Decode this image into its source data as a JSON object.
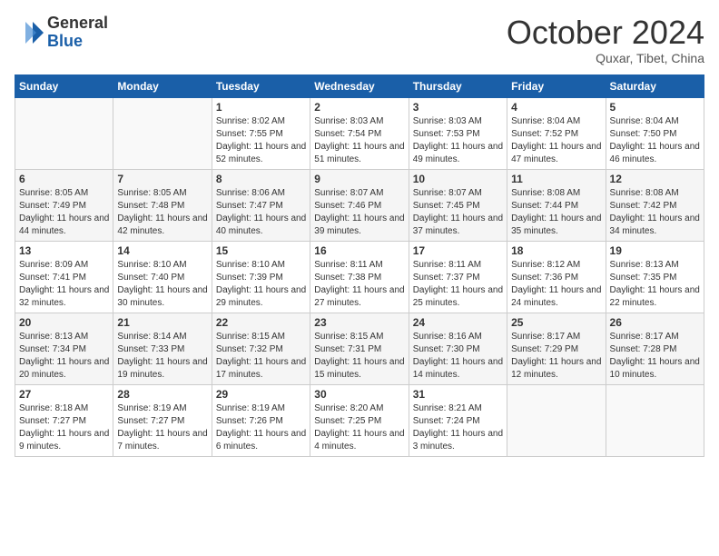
{
  "logo": {
    "general": "General",
    "blue": "Blue"
  },
  "title": "October 2024",
  "subtitle": "Quxar, Tibet, China",
  "days_header": [
    "Sunday",
    "Monday",
    "Tuesday",
    "Wednesday",
    "Thursday",
    "Friday",
    "Saturday"
  ],
  "weeks": [
    [
      {
        "num": "",
        "info": ""
      },
      {
        "num": "",
        "info": ""
      },
      {
        "num": "1",
        "info": "Sunrise: 8:02 AM\nSunset: 7:55 PM\nDaylight: 11 hours and 52 minutes."
      },
      {
        "num": "2",
        "info": "Sunrise: 8:03 AM\nSunset: 7:54 PM\nDaylight: 11 hours and 51 minutes."
      },
      {
        "num": "3",
        "info": "Sunrise: 8:03 AM\nSunset: 7:53 PM\nDaylight: 11 hours and 49 minutes."
      },
      {
        "num": "4",
        "info": "Sunrise: 8:04 AM\nSunset: 7:52 PM\nDaylight: 11 hours and 47 minutes."
      },
      {
        "num": "5",
        "info": "Sunrise: 8:04 AM\nSunset: 7:50 PM\nDaylight: 11 hours and 46 minutes."
      }
    ],
    [
      {
        "num": "6",
        "info": "Sunrise: 8:05 AM\nSunset: 7:49 PM\nDaylight: 11 hours and 44 minutes."
      },
      {
        "num": "7",
        "info": "Sunrise: 8:05 AM\nSunset: 7:48 PM\nDaylight: 11 hours and 42 minutes."
      },
      {
        "num": "8",
        "info": "Sunrise: 8:06 AM\nSunset: 7:47 PM\nDaylight: 11 hours and 40 minutes."
      },
      {
        "num": "9",
        "info": "Sunrise: 8:07 AM\nSunset: 7:46 PM\nDaylight: 11 hours and 39 minutes."
      },
      {
        "num": "10",
        "info": "Sunrise: 8:07 AM\nSunset: 7:45 PM\nDaylight: 11 hours and 37 minutes."
      },
      {
        "num": "11",
        "info": "Sunrise: 8:08 AM\nSunset: 7:44 PM\nDaylight: 11 hours and 35 minutes."
      },
      {
        "num": "12",
        "info": "Sunrise: 8:08 AM\nSunset: 7:42 PM\nDaylight: 11 hours and 34 minutes."
      }
    ],
    [
      {
        "num": "13",
        "info": "Sunrise: 8:09 AM\nSunset: 7:41 PM\nDaylight: 11 hours and 32 minutes."
      },
      {
        "num": "14",
        "info": "Sunrise: 8:10 AM\nSunset: 7:40 PM\nDaylight: 11 hours and 30 minutes."
      },
      {
        "num": "15",
        "info": "Sunrise: 8:10 AM\nSunset: 7:39 PM\nDaylight: 11 hours and 29 minutes."
      },
      {
        "num": "16",
        "info": "Sunrise: 8:11 AM\nSunset: 7:38 PM\nDaylight: 11 hours and 27 minutes."
      },
      {
        "num": "17",
        "info": "Sunrise: 8:11 AM\nSunset: 7:37 PM\nDaylight: 11 hours and 25 minutes."
      },
      {
        "num": "18",
        "info": "Sunrise: 8:12 AM\nSunset: 7:36 PM\nDaylight: 11 hours and 24 minutes."
      },
      {
        "num": "19",
        "info": "Sunrise: 8:13 AM\nSunset: 7:35 PM\nDaylight: 11 hours and 22 minutes."
      }
    ],
    [
      {
        "num": "20",
        "info": "Sunrise: 8:13 AM\nSunset: 7:34 PM\nDaylight: 11 hours and 20 minutes."
      },
      {
        "num": "21",
        "info": "Sunrise: 8:14 AM\nSunset: 7:33 PM\nDaylight: 11 hours and 19 minutes."
      },
      {
        "num": "22",
        "info": "Sunrise: 8:15 AM\nSunset: 7:32 PM\nDaylight: 11 hours and 17 minutes."
      },
      {
        "num": "23",
        "info": "Sunrise: 8:15 AM\nSunset: 7:31 PM\nDaylight: 11 hours and 15 minutes."
      },
      {
        "num": "24",
        "info": "Sunrise: 8:16 AM\nSunset: 7:30 PM\nDaylight: 11 hours and 14 minutes."
      },
      {
        "num": "25",
        "info": "Sunrise: 8:17 AM\nSunset: 7:29 PM\nDaylight: 11 hours and 12 minutes."
      },
      {
        "num": "26",
        "info": "Sunrise: 8:17 AM\nSunset: 7:28 PM\nDaylight: 11 hours and 10 minutes."
      }
    ],
    [
      {
        "num": "27",
        "info": "Sunrise: 8:18 AM\nSunset: 7:27 PM\nDaylight: 11 hours and 9 minutes."
      },
      {
        "num": "28",
        "info": "Sunrise: 8:19 AM\nSunset: 7:27 PM\nDaylight: 11 hours and 7 minutes."
      },
      {
        "num": "29",
        "info": "Sunrise: 8:19 AM\nSunset: 7:26 PM\nDaylight: 11 hours and 6 minutes."
      },
      {
        "num": "30",
        "info": "Sunrise: 8:20 AM\nSunset: 7:25 PM\nDaylight: 11 hours and 4 minutes."
      },
      {
        "num": "31",
        "info": "Sunrise: 8:21 AM\nSunset: 7:24 PM\nDaylight: 11 hours and 3 minutes."
      },
      {
        "num": "",
        "info": ""
      },
      {
        "num": "",
        "info": ""
      }
    ]
  ]
}
